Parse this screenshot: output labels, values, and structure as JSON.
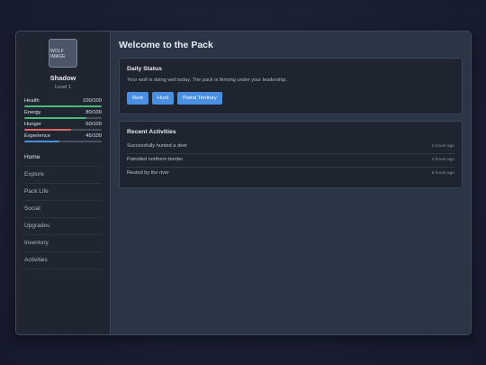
{
  "player": {
    "avatar_text": "WOLF IMAGE",
    "name": "Shadow",
    "level": "Level 1"
  },
  "stats": [
    {
      "label": "Health",
      "value": "100/100",
      "fraction": 1.0,
      "color": "#48bb78"
    },
    {
      "label": "Energy",
      "value": "80/100",
      "fraction": 0.8,
      "color": "#48bb78"
    },
    {
      "label": "Hunger",
      "value": "60/100",
      "fraction": 0.6,
      "color": "#e06666"
    },
    {
      "label": "Experience",
      "value": "45/100",
      "fraction": 0.45,
      "color": "#4a90e2"
    }
  ],
  "nav": [
    {
      "label": "Home",
      "active": true
    },
    {
      "label": "Explore"
    },
    {
      "label": "Pack Life"
    },
    {
      "label": "Social"
    },
    {
      "label": "Upgrades"
    },
    {
      "label": "Inventory"
    },
    {
      "label": "Activities"
    }
  ],
  "main": {
    "title": "Welcome to the Pack",
    "daily_status": {
      "title": "Daily Status",
      "text": "Your wolf is doing well today. The pack is thriving under your leadership.",
      "buttons": [
        "Rest",
        "Hunt",
        "Patrol Territory"
      ]
    },
    "recent": {
      "title": "Recent Activities",
      "items": [
        {
          "text": "Successfully hunted a deer",
          "time": "2 hours ago"
        },
        {
          "text": "Patrolled northern border",
          "time": "4 hours ago"
        },
        {
          "text": "Rested by the river",
          "time": "6 hours ago"
        }
      ]
    }
  },
  "colors": {
    "accent": "#4a90e2",
    "health": "#48bb78",
    "hunger": "#e06666"
  }
}
